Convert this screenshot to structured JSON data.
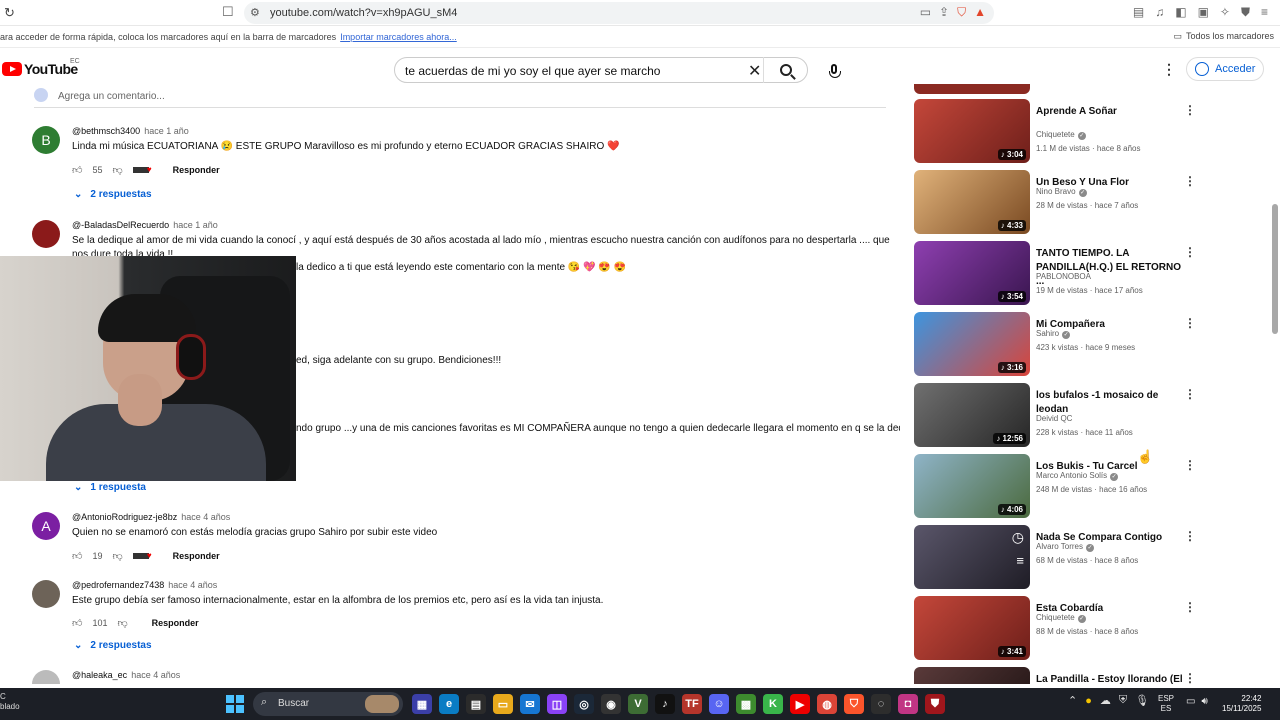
{
  "browser": {
    "url": "youtube.com/watch?v=xh9pAGU_sM4",
    "bookmark_hint": "ara acceder de forma rápida, coloca los marcadores aquí en la barra de marcadores",
    "bookmark_import": "Importar marcadores ahora...",
    "all_bookmarks": "Todos los marcadores"
  },
  "header": {
    "logo_text": "YouTube",
    "logo_country": "EC",
    "search_value": "te acuerdas de mi yo soy el que ayer se marcho",
    "sign_in": "Acceder"
  },
  "comments": {
    "add_placeholder": "Agrega un comentario...",
    "reply_label": "Responder",
    "items": [
      {
        "avatar_letter": "B",
        "avatar_color": "#2e7d32",
        "handle": "@bethmsch3400",
        "age": "hace 1 año",
        "text": "Linda mi música ECUATORIANA 😢 ESTE GRUPO Maravilloso es mi profundo y eterno ECUADOR GRACIAS SHAIRO ❤️",
        "likes": "55",
        "replies": "2 respuestas"
      },
      {
        "avatar_letter": "",
        "avatar_color": "#8b1a1a",
        "handle": "@-BaladasDelRecuerdo",
        "age": "hace 1 año",
        "text": "Se la dedique al amor de mi vida cuando la conocí , y aquí está después de 30 años acostada al lado mío , mientras escucho nuestra canción con audífonos para no despertarla .... que nos dure toda la vida !!",
        "text2": "la dedico a ti que está leyendo este comentario con la mente 😘 💖 😍 😍",
        "text3": "ed, siga adelante con su grupo. Bendiciones!!!",
        "text4": "ndo grupo ...y una de mis canciones favoritas es MI COMPAÑERA aunque no tengo a quien dedecarle llegara el momento en q se la dedique",
        "replies": "1 respuesta"
      },
      {
        "avatar_letter": "A",
        "avatar_color": "#7b1fa2",
        "handle": "@AntonioRodriguez-je8bz",
        "age": "hace 4 años",
        "text": "Quien no se enamoró con estás melodía gracias grupo Sahiro por subir este video",
        "likes": "19"
      },
      {
        "avatar_letter": "",
        "avatar_color": "#6d6358",
        "handle": "@pedrofernandez7438",
        "age": "hace 4 años",
        "text": "Este grupo debía ser famoso internacionalmente, estar en la alfombra de los premios etc, pero así es la vida tan injusta.",
        "likes": "101",
        "replies": "2 respuestas"
      },
      {
        "avatar_letter": "",
        "avatar_color": "#bbbbbb",
        "handle": "@haleaka_ec",
        "age": "hace 4 años"
      }
    ]
  },
  "related": [
    {
      "title": "Aprende A Soñar",
      "channel": "Chiquetete",
      "verified": true,
      "stats": "1.1 M de vistas · hace 8 años",
      "duration": "♪ 3:04",
      "thumb_color": "#b3362c"
    },
    {
      "title": "Un Beso Y Una Flor",
      "channel": "Nino Bravo",
      "verified": true,
      "stats": "28 M de vistas · hace 7 años",
      "duration": "♪ 4:33",
      "thumb_color": "#c98a4a"
    },
    {
      "title": "TANTO TIEMPO. LA PANDILLA(H.Q.) EL RETORNO ...",
      "channel": "PABLONOBOA",
      "verified": false,
      "stats": "19 M de vistas · hace 17 años",
      "duration": "♪ 3:54",
      "thumb_color": "#6a2f86"
    },
    {
      "title": "Mi Compañera",
      "channel": "Sahiro",
      "verified": true,
      "stats": "423 k vistas · hace 9 meses",
      "duration": "♪ 3:16",
      "thumb_color": "#2d7fc9"
    },
    {
      "title": "los bufalos -1 mosaico de leodan",
      "channel": "Deivid QC",
      "verified": false,
      "stats": "228 k vistas · hace 11 años",
      "duration": "♪ 12:56",
      "thumb_color": "#4c4c4c"
    },
    {
      "title": "Los Bukis - Tu Carcel",
      "channel": "Marco Antonio Solís",
      "verified": true,
      "stats": "248 M de vistas · hace 16 años",
      "duration": "♪ 4:06",
      "thumb_color": "#5c7c8e"
    },
    {
      "title": "Nada Se Compara Contigo",
      "channel": "Alvaro Torres",
      "verified": true,
      "stats": "68 M de vistas · hace 8 años",
      "duration": "",
      "thumb_color": "#3d3a48"
    },
    {
      "title": "Esta Cobardía",
      "channel": "Chiquetete",
      "verified": true,
      "stats": "88 M de vistas · hace 8 años",
      "duration": "♪ 3:41",
      "thumb_color": "#b3362c"
    },
    {
      "title": "La Pandilla - Estoy llorando (El",
      "channel": "",
      "verified": false,
      "stats": "",
      "duration": "",
      "thumb_color": "#3a2a2a"
    }
  ],
  "taskbar": {
    "left_top": "C",
    "left_bottom": "blado",
    "search_label": "Buscar",
    "lang_top": "ESP",
    "lang_bottom": "ES",
    "time": "22:42",
    "date": "15/11/2025"
  }
}
